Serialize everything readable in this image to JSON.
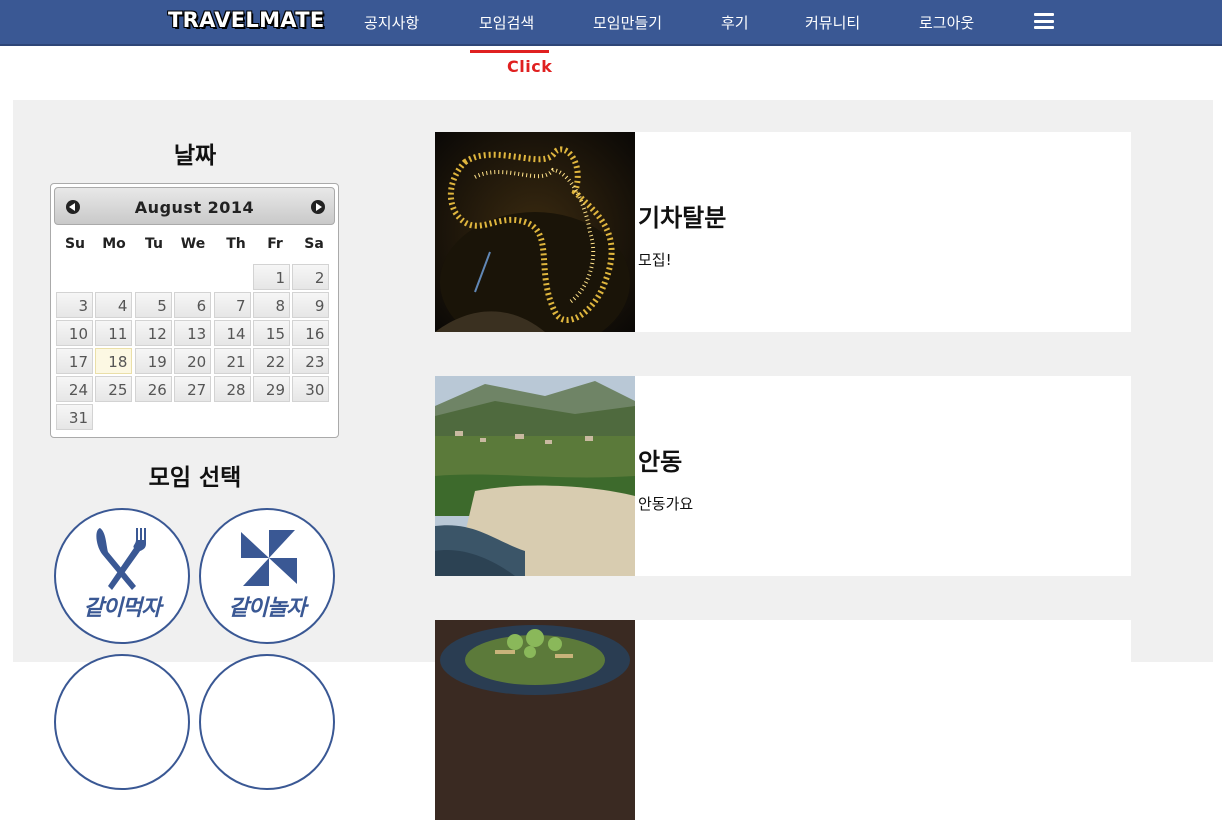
{
  "navbar": {
    "logo": "TRAVELMATE",
    "items": [
      {
        "label": "공지사항"
      },
      {
        "label": "모임검색"
      },
      {
        "label": "모임만들기"
      },
      {
        "label": "후기"
      },
      {
        "label": "커뮤니티"
      },
      {
        "label": "로그아웃"
      }
    ],
    "menu_icon": "hamburger-menu-icon",
    "active_item": "모임검색"
  },
  "annotation": {
    "click_note": "Click",
    "color": "#e02020"
  },
  "colors": {
    "brand": "#3a5894",
    "panel_bg": "#f0f0f0",
    "today_bg": "#fcf8e3"
  },
  "sidebar": {
    "date_title": "날짜",
    "calendar": {
      "month_label": "August 2014",
      "prev_icon": "prev-month-icon",
      "next_icon": "next-month-icon",
      "weekdays": [
        "Su",
        "Mo",
        "Tu",
        "We",
        "Th",
        "Fr",
        "Sa"
      ],
      "days": [
        "1",
        "2",
        "3",
        "4",
        "5",
        "6",
        "7",
        "8",
        "9",
        "10",
        "11",
        "12",
        "13",
        "14",
        "15",
        "16",
        "17",
        "18",
        "19",
        "20",
        "21",
        "22",
        "23",
        "24",
        "25",
        "26",
        "27",
        "28",
        "29",
        "30",
        "31"
      ],
      "today": "18"
    },
    "category_title": "모임 선택",
    "categories": [
      {
        "label": "같이먹자",
        "icon": "fork-knife-icon"
      },
      {
        "label": "같이놀자",
        "icon": "pinwheel-icon"
      }
    ]
  },
  "cards": [
    {
      "title": "기차탈분",
      "desc": "모집!",
      "image": "tunnel-lights-image"
    },
    {
      "title": "안동",
      "desc": "안동가요",
      "image": "river-village-image"
    },
    {
      "title": "",
      "desc": "",
      "image": "food-dish-image"
    }
  ]
}
